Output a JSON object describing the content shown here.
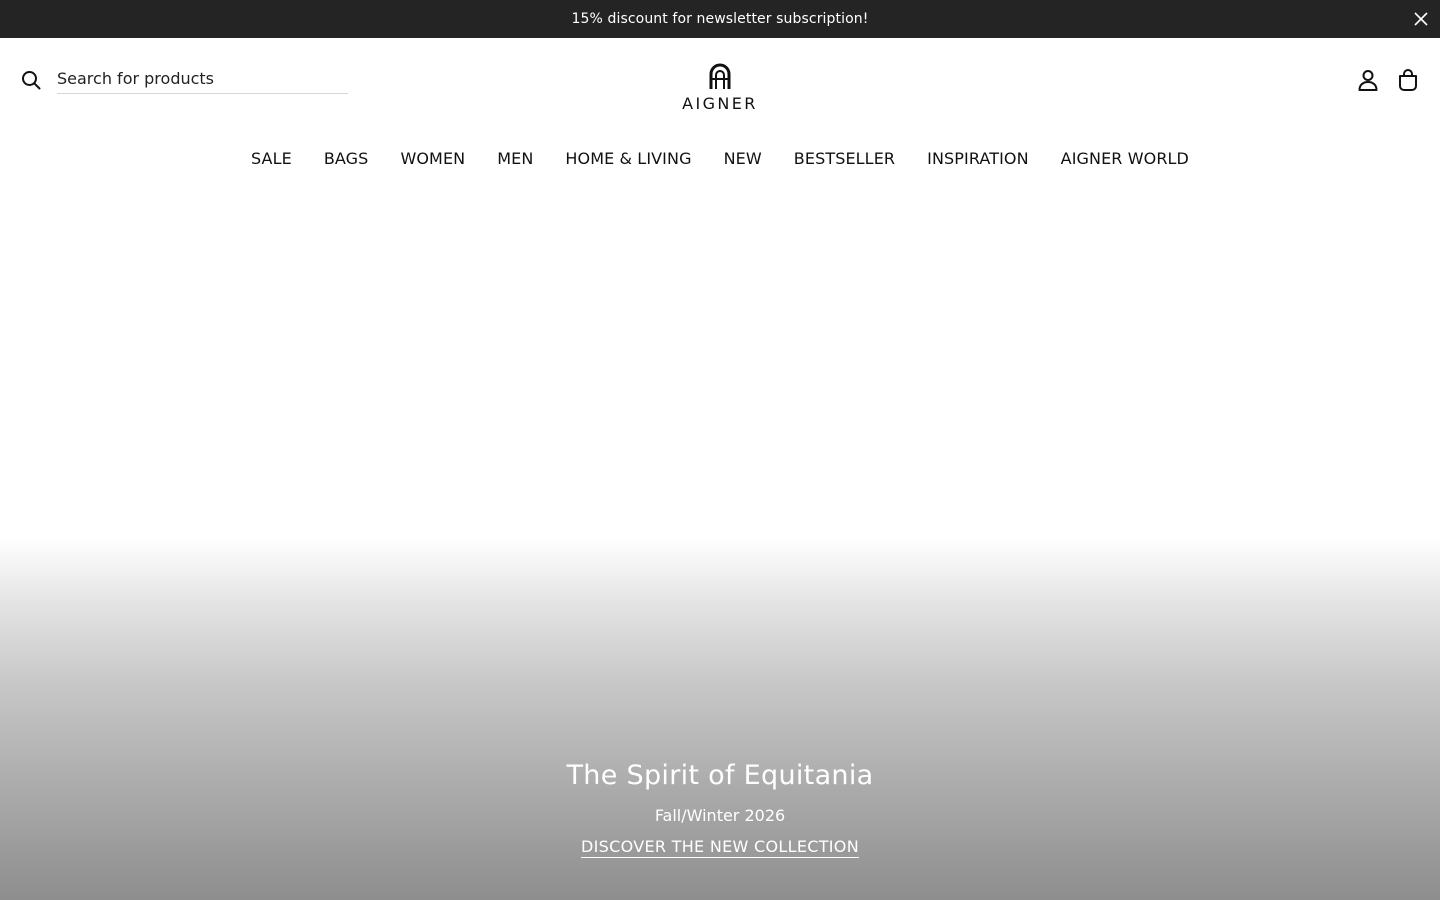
{
  "promo": {
    "text": "15% discount for newsletter subscription!",
    "close_icon": "close-icon",
    "background": "#242424"
  },
  "header": {
    "search": {
      "placeholder": "Search for products",
      "icon": "search-icon"
    },
    "logo": {
      "wordmark": "AIGNER",
      "icon": "horseshoe-a-logo"
    },
    "account_icon": "user-icon",
    "cart_icon": "shopping-bag-icon"
  },
  "nav": {
    "items": [
      {
        "label": "SALE"
      },
      {
        "label": "BAGS"
      },
      {
        "label": "WOMEN"
      },
      {
        "label": "MEN"
      },
      {
        "label": "HOME & LIVING"
      },
      {
        "label": "NEW"
      },
      {
        "label": "BESTSELLER"
      },
      {
        "label": "INSPIRATION"
      },
      {
        "label": "AIGNER WORLD"
      }
    ]
  },
  "hero": {
    "title": "The Spirit of Equitania",
    "subtitle": "Fall/Winter 2026",
    "cta": "DISCOVER THE NEW COLLECTION",
    "text_color": "#ffffff"
  }
}
